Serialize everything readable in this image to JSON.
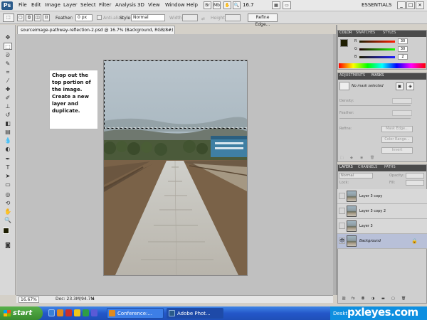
{
  "menu": {
    "logo": "Ps",
    "items": [
      "File",
      "Edit",
      "Image",
      "Layer",
      "Select",
      "Filter",
      "Analysis",
      "3D",
      "View",
      "Window",
      "Help"
    ],
    "zoom": "16.7",
    "workspace": "ESSENTIALS",
    "win_min": "_",
    "win_max": "□",
    "win_close": "×"
  },
  "options": {
    "feather_label": "Feather:",
    "feather_value": "0 px",
    "antialias_label": "Anti-alias",
    "style_label": "Style:",
    "style_value": "Normal",
    "width_label": "Width:",
    "height_label": "Height:",
    "refine_edge": "Refine Edge..."
  },
  "document": {
    "tab_title": "sourceimage-pathway-reflection-2.psd @ 16.7% (Background, RGB/8#) ×",
    "note_text": "Chop out the top portion of the image. Create a new layer and duplicate.",
    "zoom_status": "16.67%",
    "doc_status": "Doc: 23.3M/94.7M"
  },
  "color_panel": {
    "tabs": [
      "COLOR",
      "SWATCHES",
      "STYLES"
    ],
    "r_label": "R",
    "g_label": "G",
    "b_label": "B",
    "r_value": "30",
    "g_value": "30",
    "b_value": "2"
  },
  "adjust_panel": {
    "tabs": [
      "ADJUSTMENTS",
      "MASKS"
    ],
    "status": "No mask selected",
    "density_label": "Density:",
    "feather_label": "Feather:",
    "refine_label": "Refine:",
    "mask_edge": "Mask Edge...",
    "color_range": "Color Range...",
    "invert": "Invert"
  },
  "layers_panel": {
    "tabs": [
      "LAYERS",
      "CHANNELS",
      "PATHS"
    ],
    "blend_mode": "Normal",
    "opacity_label": "Opacity:",
    "lock_label": "Lock:",
    "fill_label": "Fill:",
    "layers": [
      {
        "name": "Layer 3 copy",
        "visible": false,
        "selected": false
      },
      {
        "name": "Layer 3 copy 2",
        "visible": false,
        "selected": false
      },
      {
        "name": "Layer 3",
        "visible": false,
        "selected": false
      },
      {
        "name": "Background",
        "visible": true,
        "selected": true
      }
    ],
    "visible_glyph": "👁"
  },
  "taskbar": {
    "start": "start",
    "tasks": [
      "Conference:...",
      "Adobe Phot..."
    ],
    "tray_text": "Deskt",
    "watermark": "pxleyes.com"
  },
  "colors": {
    "foreground": "#1e1e02",
    "background": "#ffffff",
    "taskbar_blue": "#2457c9",
    "start_green": "#3a8c30",
    "panel_tab_dark": "#4b4b4b"
  }
}
